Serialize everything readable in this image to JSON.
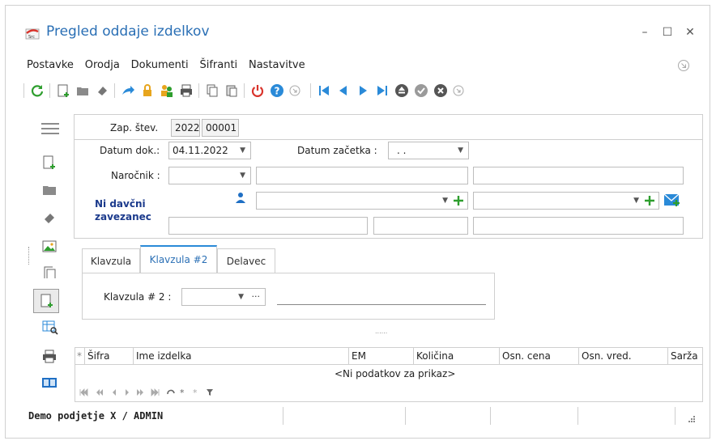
{
  "window": {
    "title": "Pregled oddaje izdelkov",
    "controls": {
      "minimize": "–",
      "maximize": "☐",
      "close": "✕"
    }
  },
  "menu": {
    "items": [
      "Postavke",
      "Orodja",
      "Dokumenti",
      "Šifranti",
      "Nastavitve"
    ]
  },
  "header": {
    "zap_stev_label": "Zap. štev.",
    "year": "2022",
    "number": "00001"
  },
  "form": {
    "datum_dok_label": "Datum dok.:",
    "datum_dok_value": "04.11.2022",
    "datum_zacetka_label": "Datum začetka :",
    "datum_zacetka_value": ". .",
    "narocnik_label": "Naročnik :",
    "ni_davcni_line1": "Ni davčni",
    "ni_davcni_line2": "zavezanec"
  },
  "tabs": [
    {
      "label": "Klavzula"
    },
    {
      "label": "Klavzula #2"
    },
    {
      "label": "Delavec"
    }
  ],
  "tab_content": {
    "klavzula2_label": "Klavzula # 2 :",
    "ellipsis": "···"
  },
  "splitter": "......",
  "grid": {
    "columns": [
      "Šifra",
      "Ime izdelka",
      "EM",
      "Količina",
      "Osn. cena",
      "Osn. vred.",
      "Sarža"
    ],
    "empty_text": "<Ni podatkov za prikaz>",
    "star": "*"
  },
  "status": {
    "company": "Demo podjetje X / ADMIN"
  },
  "colors": {
    "accent": "#2a6fb5",
    "green": "#2e9e2e",
    "red": "#d9332b",
    "dark_blue": "#1b3a8c"
  }
}
